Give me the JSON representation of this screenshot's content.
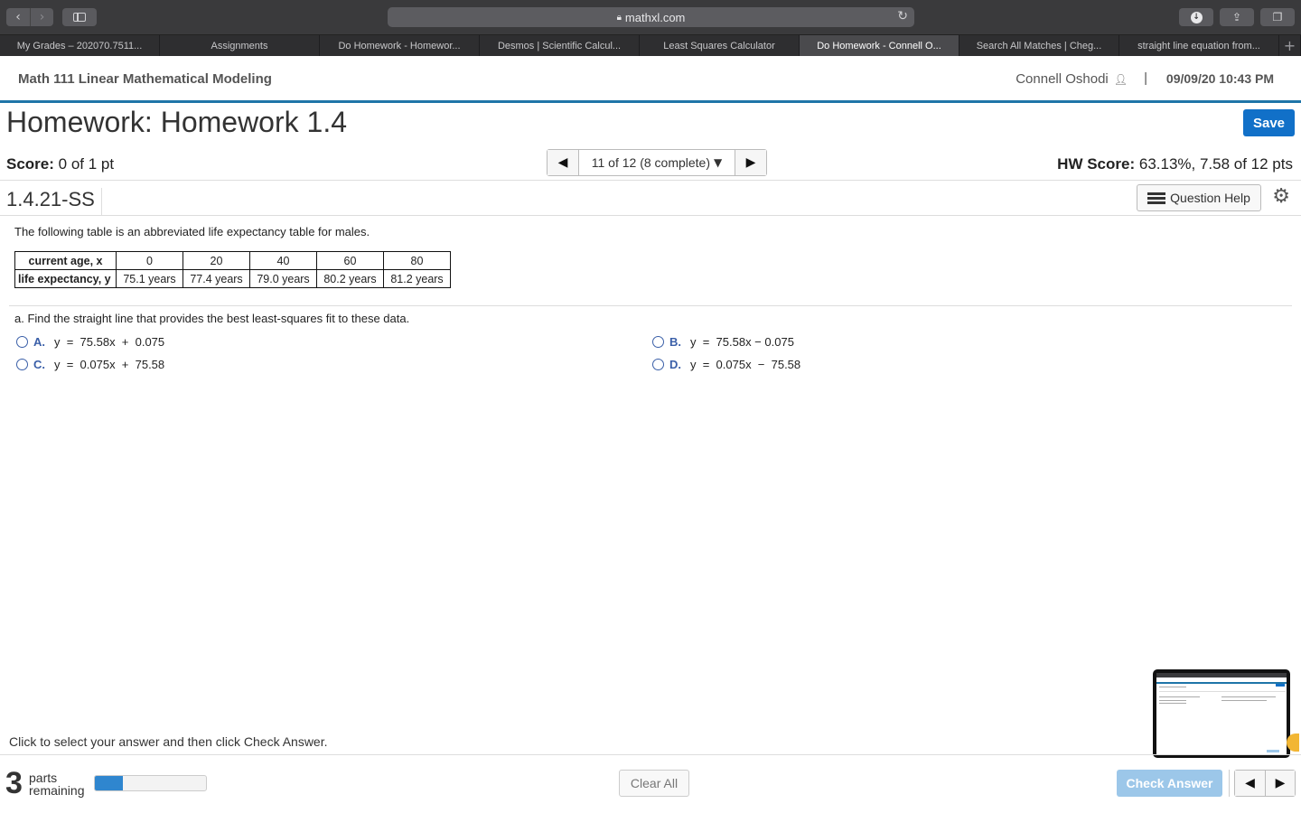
{
  "browser": {
    "url": "mathxl.com",
    "tabs": [
      {
        "label": "My Grades – 202070.7511...",
        "active": false
      },
      {
        "label": "Assignments",
        "active": false
      },
      {
        "label": "Do Homework - Homewor...",
        "active": false
      },
      {
        "label": "Desmos | Scientific Calcul...",
        "active": false
      },
      {
        "label": "Least Squares Calculator",
        "active": false
      },
      {
        "label": "Do Homework - Connell O...",
        "active": true
      },
      {
        "label": "Search All Matches | Cheg...",
        "active": false
      },
      {
        "label": "straight line equation from...",
        "active": false
      }
    ]
  },
  "header": {
    "course": "Math 111 Linear Mathematical Modeling",
    "user": "Connell Oshodi",
    "separator": "|",
    "datetime": "09/09/20 10:43 PM"
  },
  "homework": {
    "title": "Homework: Homework 1.4",
    "save_label": "Save",
    "score_label": "Score:",
    "score_value": " 0 of 1 pt",
    "pager_text": "11 of 12 (8 complete)",
    "hw_score_label": "HW Score:",
    "hw_score_value": " 63.13%, 7.58 of 12 pts",
    "question_id": "1.4.21-SS",
    "question_help": "Question Help"
  },
  "question": {
    "intro": "The following table is an abbreviated life expectancy table for males.",
    "table": {
      "row1_header": "current age, x",
      "row1": [
        "0",
        "20",
        "40",
        "60",
        "80"
      ],
      "row2_header": "life expectancy, y",
      "row2": [
        "75.1 years",
        "77.4 years",
        "79.0 years",
        "80.2 years",
        "81.2 years"
      ]
    },
    "part_a": "a. Find the straight line that provides the best least-squares fit to these data.",
    "choices": [
      {
        "letter": "A.",
        "text": "y  =  75.58x  +  0.075"
      },
      {
        "letter": "B.",
        "text": "y  =  75.58x − 0.075"
      },
      {
        "letter": "C.",
        "text": "y  =  0.075x  +  75.58"
      },
      {
        "letter": "D.",
        "text": "y  =  0.075x  −  75.58"
      }
    ]
  },
  "footer": {
    "instruction": "Click to select your answer and then click Check Answer.",
    "parts_count": "3",
    "parts_label_1": "parts",
    "parts_label_2": "remaining",
    "progress_fraction": 0.25,
    "clear_all": "Clear All",
    "check_answer": "Check Answer"
  },
  "colors": {
    "accent": "#1f75a8",
    "save_button": "#1170c8",
    "check_button": "#9cc7e9",
    "choice_letter": "#3a5fa8"
  },
  "icons": [
    "back-icon",
    "forward-icon",
    "sidebar-icon",
    "lock-icon",
    "reload-icon",
    "download-icon",
    "share-icon",
    "tabs-icon",
    "user-icon",
    "caret-down-icon",
    "list-icon",
    "gear-icon"
  ]
}
